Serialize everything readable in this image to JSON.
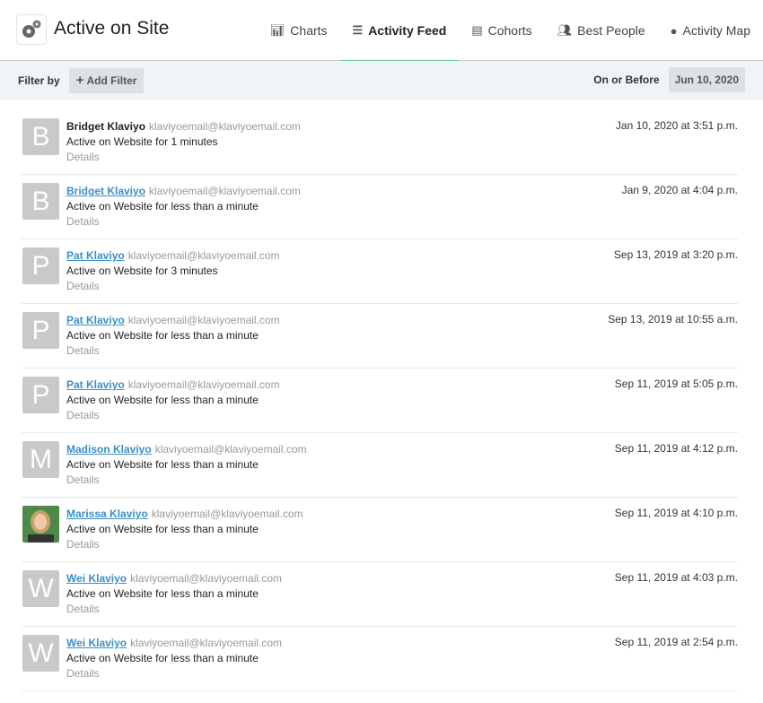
{
  "header": {
    "title": "Active on Site",
    "tabs": [
      {
        "label": "Charts",
        "icon": "bar-chart-icon",
        "active": false
      },
      {
        "label": "Activity Feed",
        "icon": "list-icon",
        "active": true
      },
      {
        "label": "Cohorts",
        "icon": "server-icon",
        "active": false
      },
      {
        "label": "Best People",
        "icon": "users-icon",
        "active": false
      },
      {
        "label": "Activity Map",
        "icon": "globe-icon",
        "active": false
      }
    ]
  },
  "filter": {
    "label": "Filter by",
    "add_filter": "Add Filter",
    "on_or_before": "On or Before",
    "date": "Jun 10, 2020"
  },
  "colors": {
    "accent": "#6cc59a",
    "link": "#3b8fc7"
  },
  "feed": [
    {
      "initial": "B",
      "name": "Bridget Klaviyo",
      "linked": false,
      "email": "klaviyoemail@klaviyoemail.com",
      "activity": "Active on Website for 1 minutes",
      "details": "Details",
      "date": "Jan 10, 2020 at 3:51 p.m."
    },
    {
      "initial": "B",
      "name": "Bridget Klaviyo",
      "linked": true,
      "email": "klaviyoemail@klaviyoemail.com",
      "activity": "Active on Website for less than a minute",
      "details": "Details",
      "date": "Jan 9, 2020 at 4:04 p.m."
    },
    {
      "initial": "P",
      "name": "Pat Klaviyo",
      "linked": true,
      "email": "klaviyoemail@klaviyoemail.com",
      "activity": "Active on Website for 3 minutes",
      "details": "Details",
      "date": "Sep 13, 2019 at 3:20 p.m."
    },
    {
      "initial": "P",
      "name": "Pat Klaviyo",
      "linked": true,
      "email": "klaviyoemail@klaviyoemail.com",
      "activity": "Active on Website for less than a minute",
      "details": "Details",
      "date": "Sep 13, 2019 at 10:55 a.m."
    },
    {
      "initial": "P",
      "name": "Pat Klaviyo",
      "linked": true,
      "email": "klaviyoemail@klaviyoemail.com",
      "activity": "Active on Website for less than a minute",
      "details": "Details",
      "date": "Sep 11, 2019 at 5:05 p.m."
    },
    {
      "initial": "M",
      "name": "Madison Klaviyo",
      "linked": true,
      "email": "klaviyoemail@klaviyoemail.com",
      "activity": "Active on Website for less than a minute",
      "details": "Details",
      "date": "Sep 11, 2019 at 4:12 p.m."
    },
    {
      "initial": "",
      "photo": true,
      "name": "Marissa Klaviyo",
      "linked": true,
      "email": "klaviyoemail@klaviyoemail.com",
      "activity": "Active on Website for less than a minute",
      "details": "Details",
      "date": "Sep 11, 2019 at 4:10 p.m."
    },
    {
      "initial": "W",
      "name": "Wei Klaviyo",
      "linked": true,
      "email": "klaviyoemail@klaviyoemail.com",
      "activity": "Active on Website for less than a minute",
      "details": "Details",
      "date": "Sep 11, 2019 at 4:03 p.m."
    },
    {
      "initial": "W",
      "name": "Wei Klaviyo",
      "linked": true,
      "email": "klaviyoemail@klaviyoemail.com",
      "activity": "Active on Website for less than a minute",
      "details": "Details",
      "date": "Sep 11, 2019 at 2:54 p.m."
    }
  ]
}
